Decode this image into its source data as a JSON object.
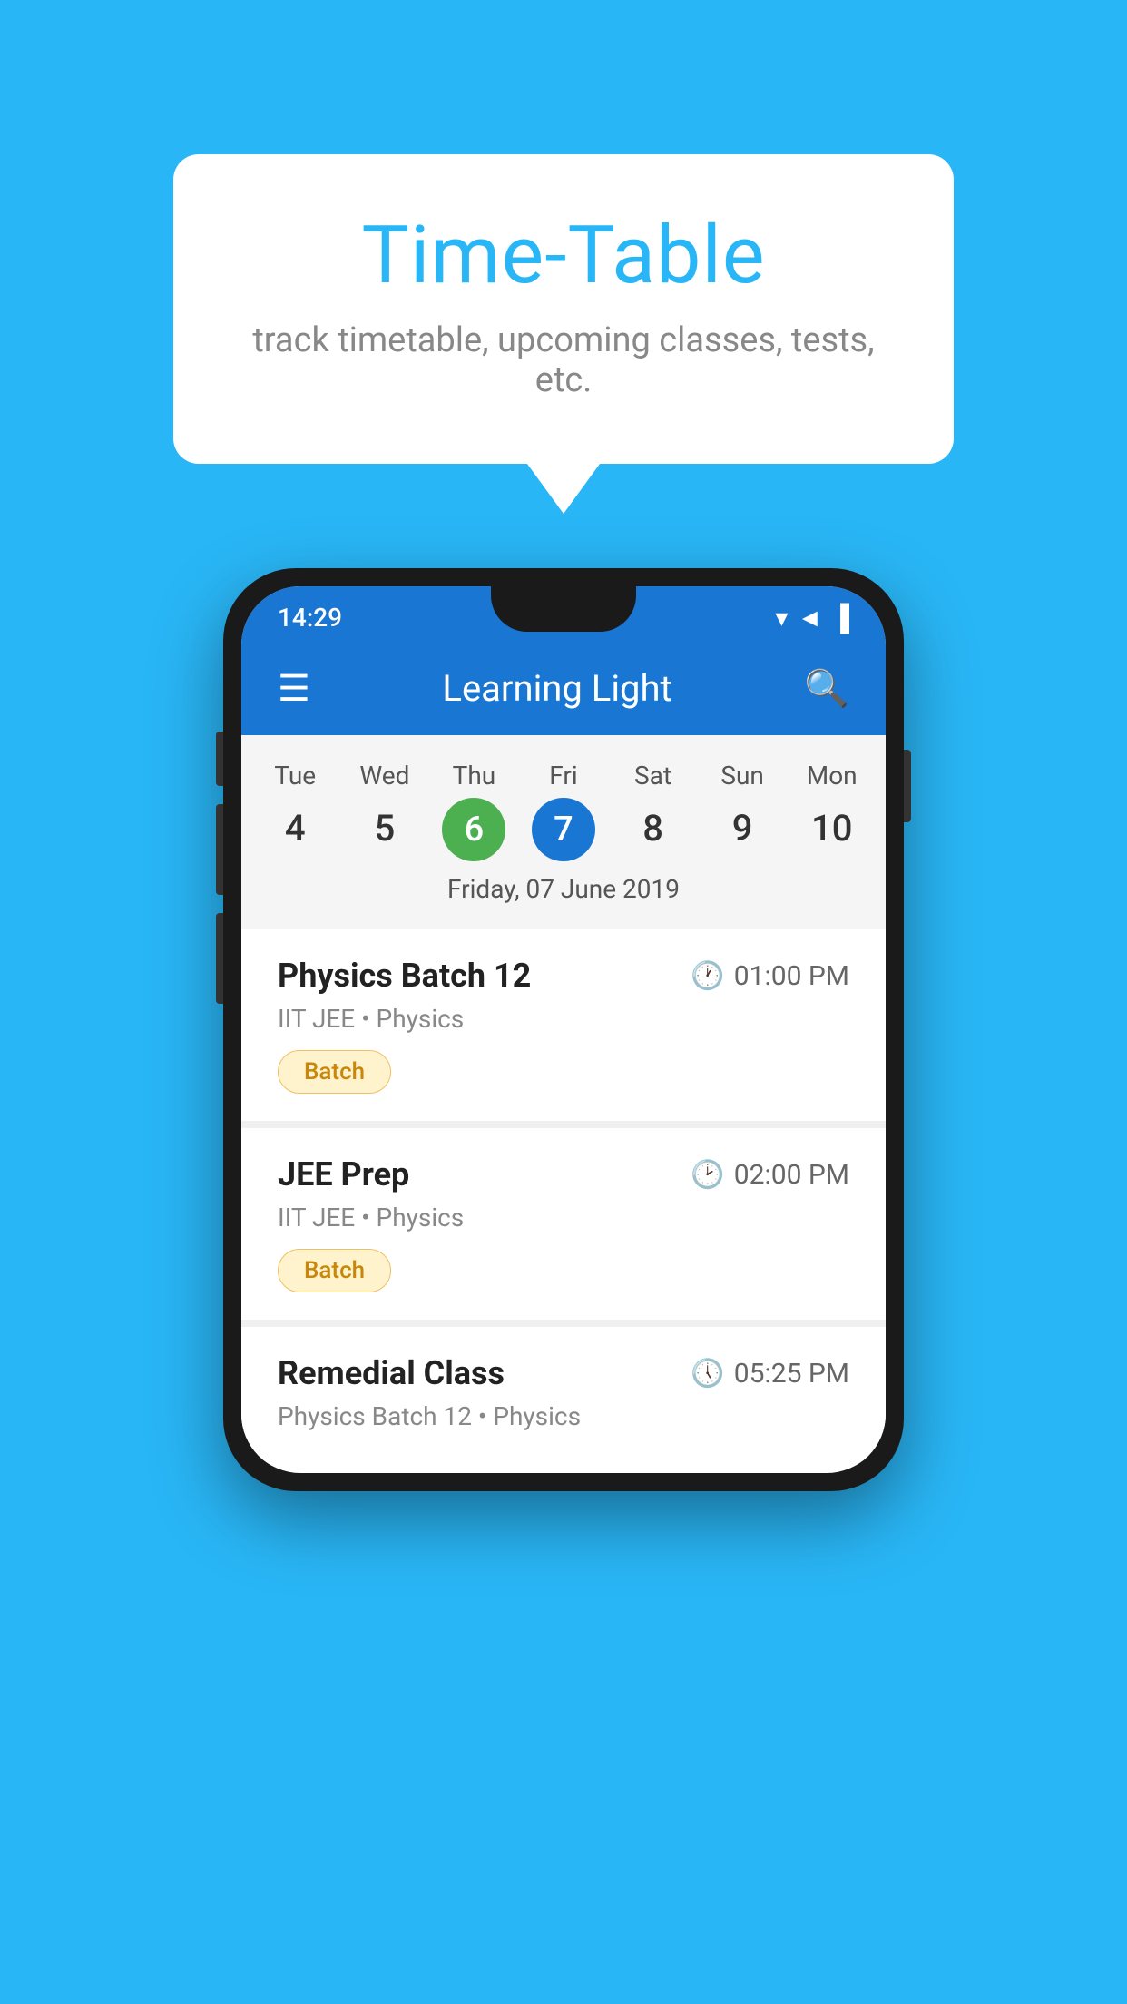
{
  "background_color": "#29b6f6",
  "speech_bubble": {
    "title": "Time-Table",
    "subtitle": "track timetable, upcoming classes, tests, etc."
  },
  "phone": {
    "status_bar": {
      "time": "14:29",
      "icons": "▼◄▐"
    },
    "app_bar": {
      "title": "Learning Light",
      "menu_icon": "☰",
      "search_icon": "🔍"
    },
    "calendar": {
      "days": [
        "Tue",
        "Wed",
        "Thu",
        "Fri",
        "Sat",
        "Sun",
        "Mon"
      ],
      "numbers": [
        "4",
        "5",
        "6",
        "7",
        "8",
        "9",
        "10"
      ],
      "today_green_index": 2,
      "today_blue_index": 3,
      "selected_date": "Friday, 07 June 2019"
    },
    "schedule": [
      {
        "title": "Physics Batch 12",
        "time": "01:00 PM",
        "subtitle": "IIT JEE • Physics",
        "badge": "Batch"
      },
      {
        "title": "JEE Prep",
        "time": "02:00 PM",
        "subtitle": "IIT JEE • Physics",
        "badge": "Batch"
      },
      {
        "title": "Remedial Class",
        "time": "05:25 PM",
        "subtitle": "Physics Batch 12 • Physics",
        "badge": ""
      }
    ]
  }
}
